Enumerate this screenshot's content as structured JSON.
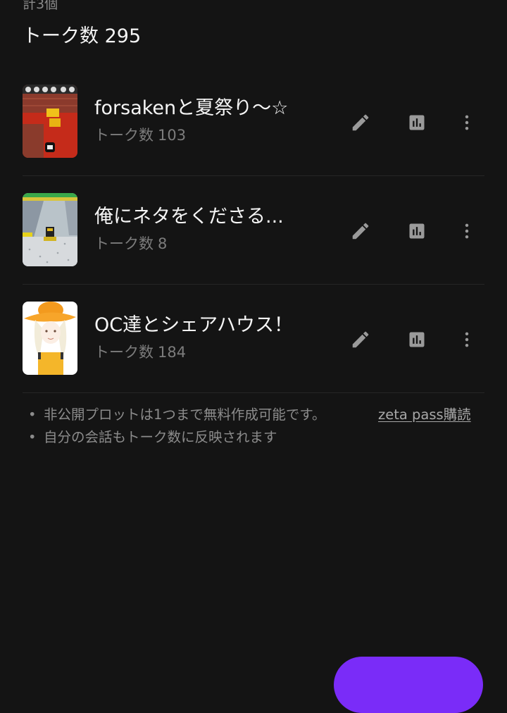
{
  "summary": {
    "count_label": "計3個",
    "total_label": "トーク数 295"
  },
  "plots": [
    {
      "title": "forsakenと夏祭り〜☆",
      "talk_label": "トーク数",
      "talk_count": "103"
    },
    {
      "title": "俺にネタをくださる...",
      "talk_label": "トーク数",
      "talk_count": "8"
    },
    {
      "title": "OC達とシェアハウス！",
      "talk_label": "トーク数",
      "talk_count": "184"
    }
  ],
  "notes": {
    "line1": "非公開プロットは1つまで無料作成可能です。",
    "link": "zeta pass購読",
    "line2": "自分の会話もトーク数に反映されます",
    "bullet": "•"
  },
  "icons": {
    "edit": "pencil-icon",
    "stats": "bar-chart-icon",
    "more": "more-vertical-icon"
  },
  "colors": {
    "background": "#141414",
    "accent": "#7a2cf8",
    "icon": "#9a9a9a"
  }
}
